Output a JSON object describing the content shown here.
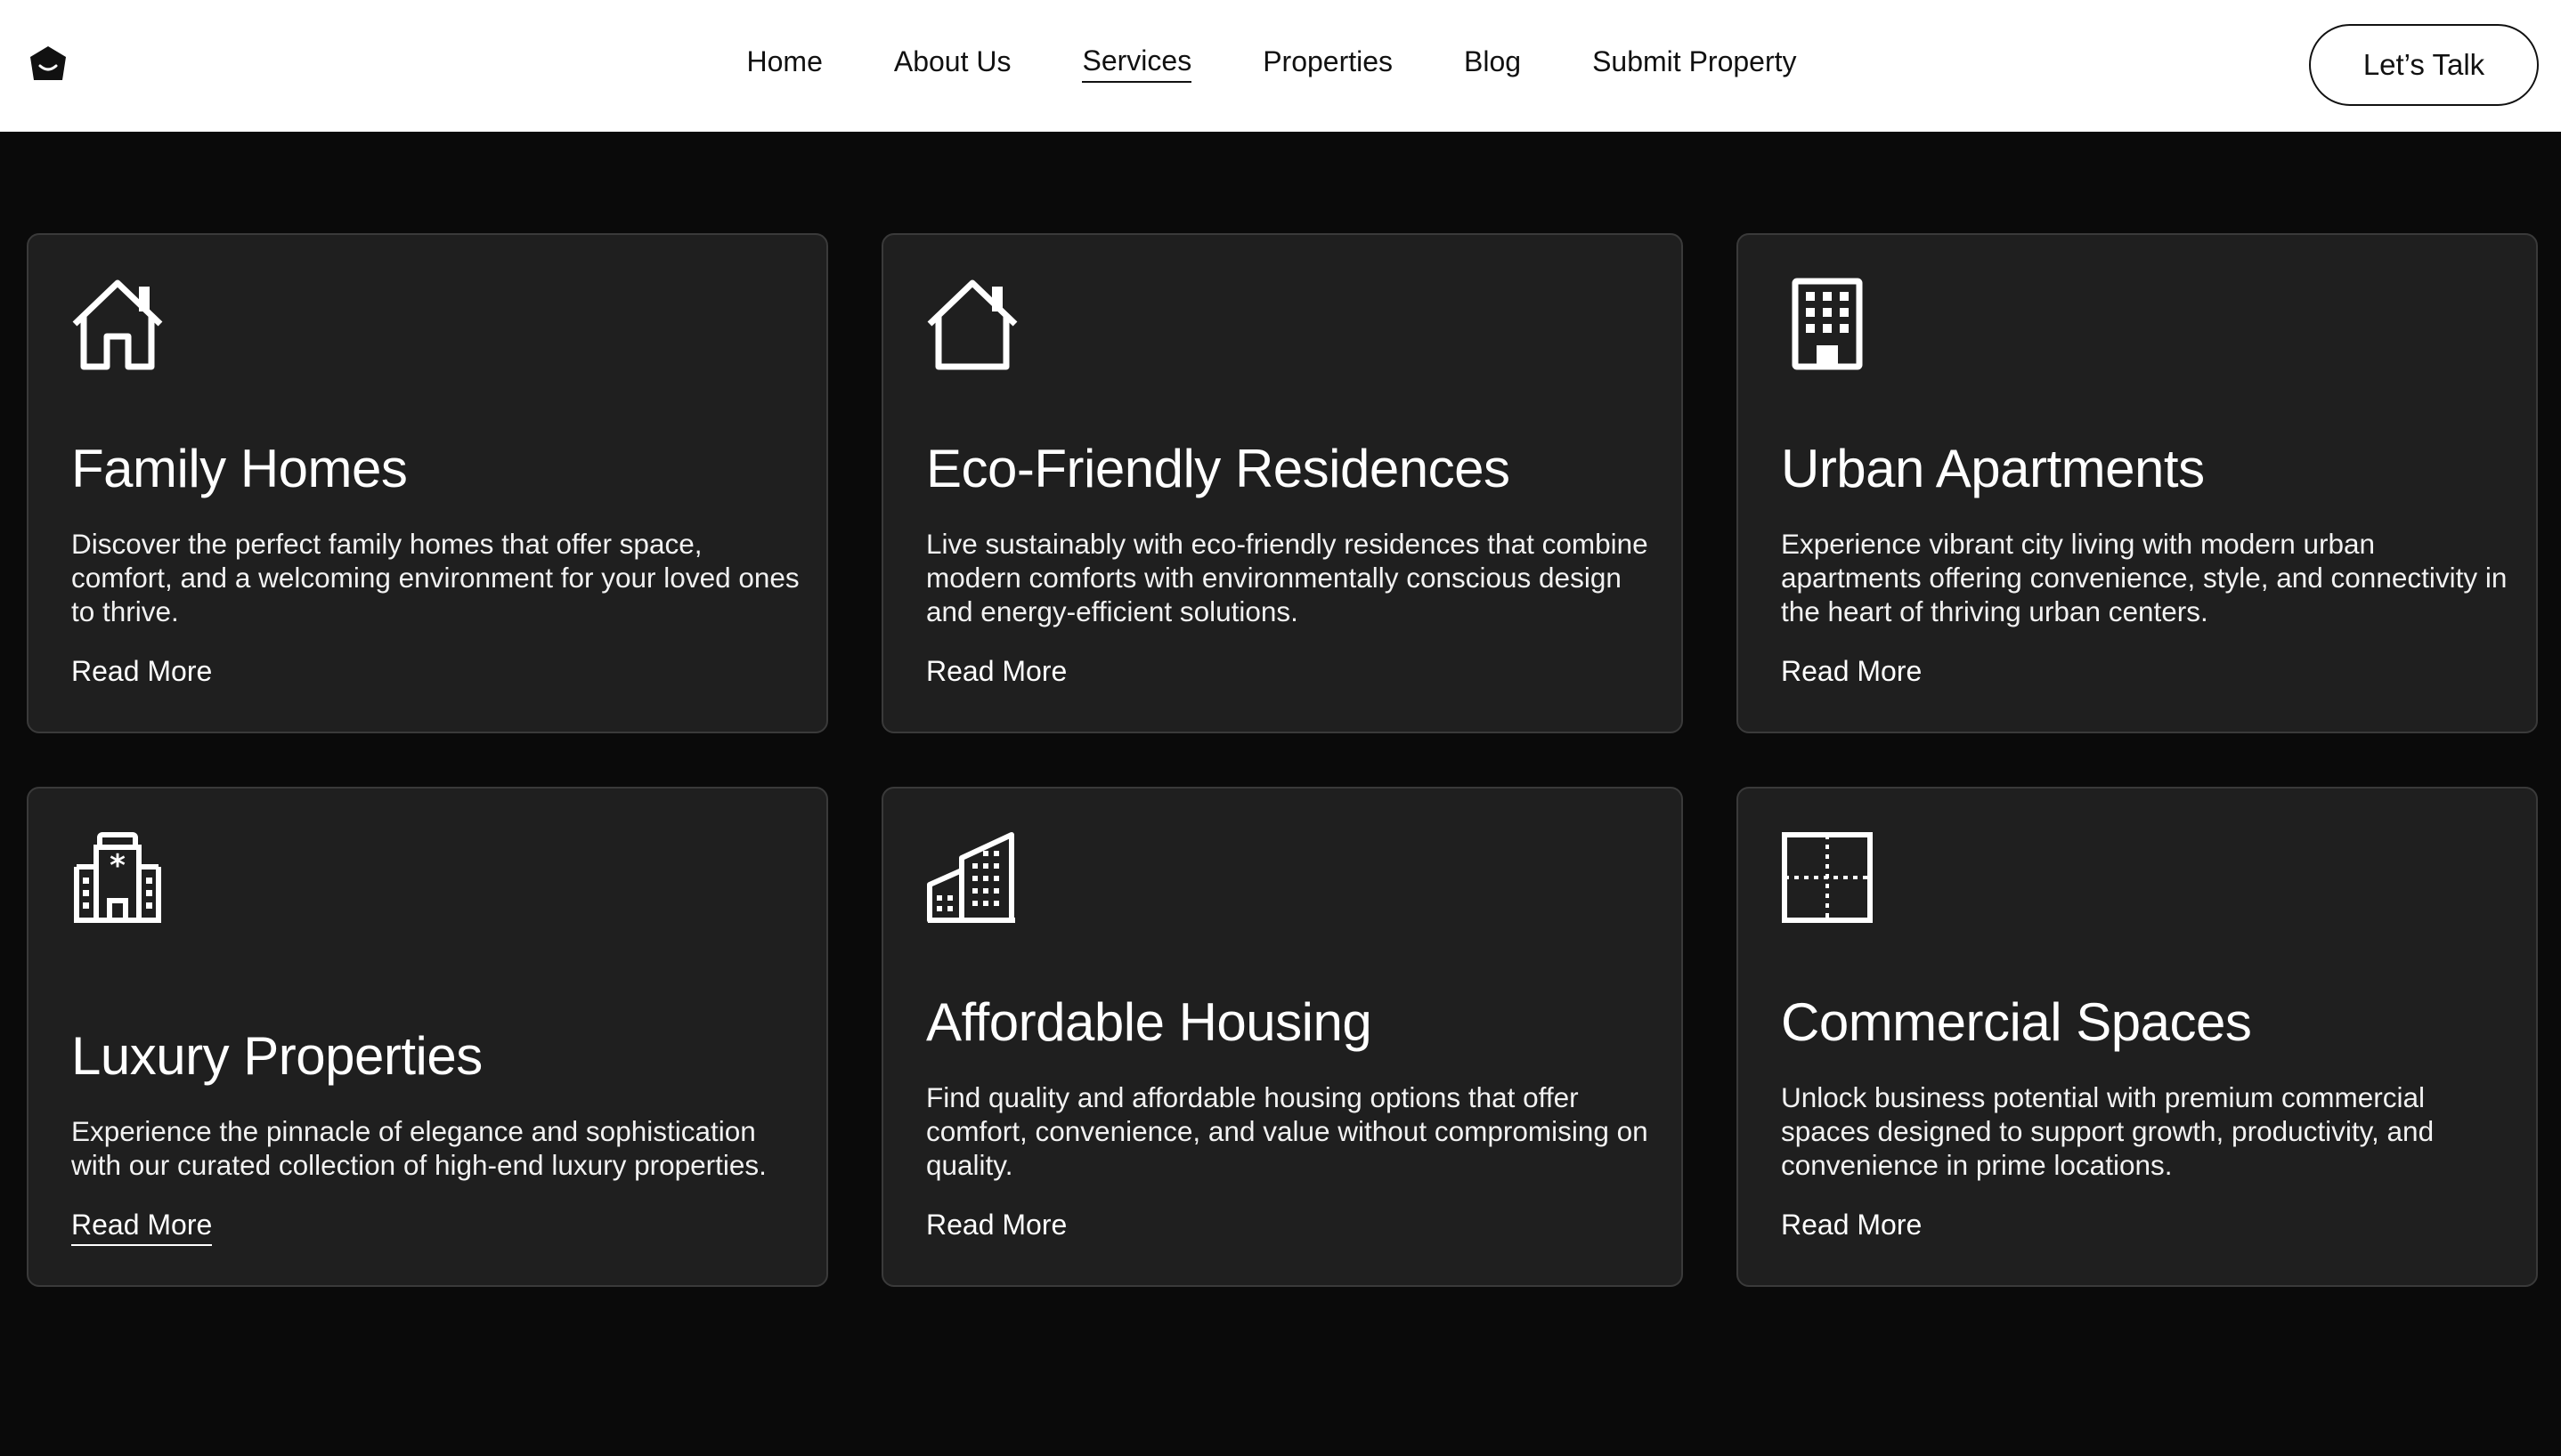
{
  "header": {
    "logo_icon": "pentagon-logo-icon",
    "nav": [
      {
        "label": "Home",
        "active": false
      },
      {
        "label": "About Us",
        "active": false
      },
      {
        "label": "Services",
        "active": true
      },
      {
        "label": "Properties",
        "active": false
      },
      {
        "label": "Blog",
        "active": false
      },
      {
        "label": "Submit Property",
        "active": false
      }
    ],
    "cta_label": "Let’s Talk"
  },
  "services": [
    {
      "icon": "house-icon",
      "title": "Family Homes",
      "description": "Discover the perfect family homes that offer space, comfort, and a welcoming environment for your loved ones to thrive.",
      "link": "Read More"
    },
    {
      "icon": "house-outline-icon",
      "title": "Eco-Friendly Residences",
      "description": "Live sustainably with eco-friendly residences that combine modern comforts with environmentally conscious design and energy-efficient solutions.",
      "link": "Read More"
    },
    {
      "icon": "apartment-building-icon",
      "title": "Urban Apartments",
      "description": "Experience vibrant city living with modern urban apartments offering convenience, style, and connectivity in the heart of thriving urban centers.",
      "link": "Read More"
    },
    {
      "icon": "hotel-building-icon",
      "title": "Luxury Properties",
      "description": "Experience the pinnacle of elegance and sophistication with our curated collection of high-end luxury properties.",
      "link": "Read More"
    },
    {
      "icon": "city-buildings-icon",
      "title": "Affordable Housing",
      "description": "Find quality and affordable housing options that offer comfort, convenience, and value without compromising on quality.",
      "link": "Read More"
    },
    {
      "icon": "floor-plan-icon",
      "title": "Commercial Spaces",
      "description": "Unlock business potential with premium commercial spaces designed to support growth, productivity, and convenience in prime locations.",
      "link": "Read More"
    }
  ],
  "colors": {
    "page_background": "#0a0a0a",
    "card_background": "#1f1f1f",
    "card_border": "#3a3a3a",
    "header_background": "#ffffff"
  }
}
